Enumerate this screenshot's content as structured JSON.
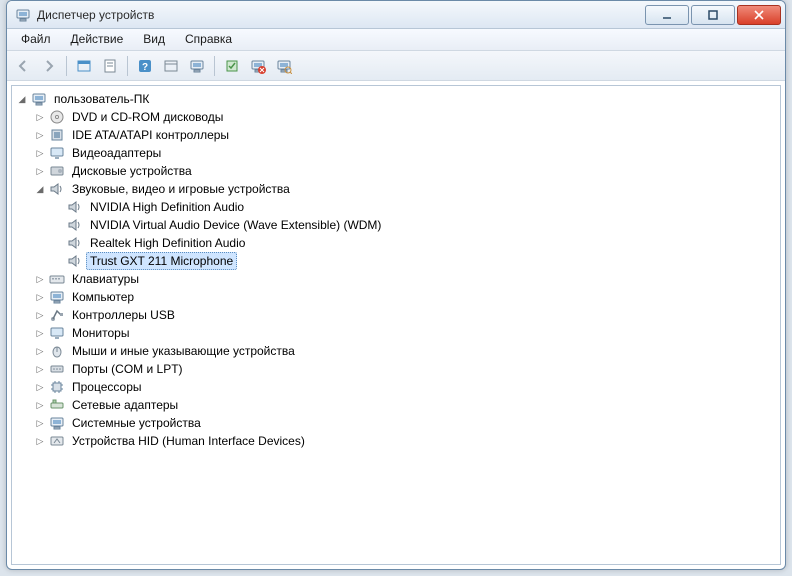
{
  "window": {
    "title": "Диспетчер устройств"
  },
  "menu": {
    "file": "Файл",
    "action": "Действие",
    "view": "Вид",
    "help": "Справка"
  },
  "tree": {
    "root": "пользователь-ПК",
    "dvd": "DVD и CD-ROM дисководы",
    "ide": "IDE ATA/ATAPI контроллеры",
    "video": "Видеоадаптеры",
    "disk": "Дисковые устройства",
    "sound": "Звуковые, видео и игровые устройства",
    "sound_children": {
      "nvidia_hd": "NVIDIA High Definition Audio",
      "nvidia_virtual": "NVIDIA Virtual Audio Device (Wave Extensible) (WDM)",
      "realtek": "Realtek High Definition Audio",
      "trust": "Trust GXT 211 Microphone"
    },
    "keyboards": "Клавиатуры",
    "computer": "Компьютер",
    "usb": "Контроллеры USB",
    "monitors": "Мониторы",
    "mice": "Мыши и иные указывающие устройства",
    "ports": "Порты (COM и LPT)",
    "cpu": "Процессоры",
    "network": "Сетевые адаптеры",
    "system": "Системные устройства",
    "hid": "Устройства HID (Human Interface Devices)"
  },
  "selected_path": "tree.sound_children.trust"
}
